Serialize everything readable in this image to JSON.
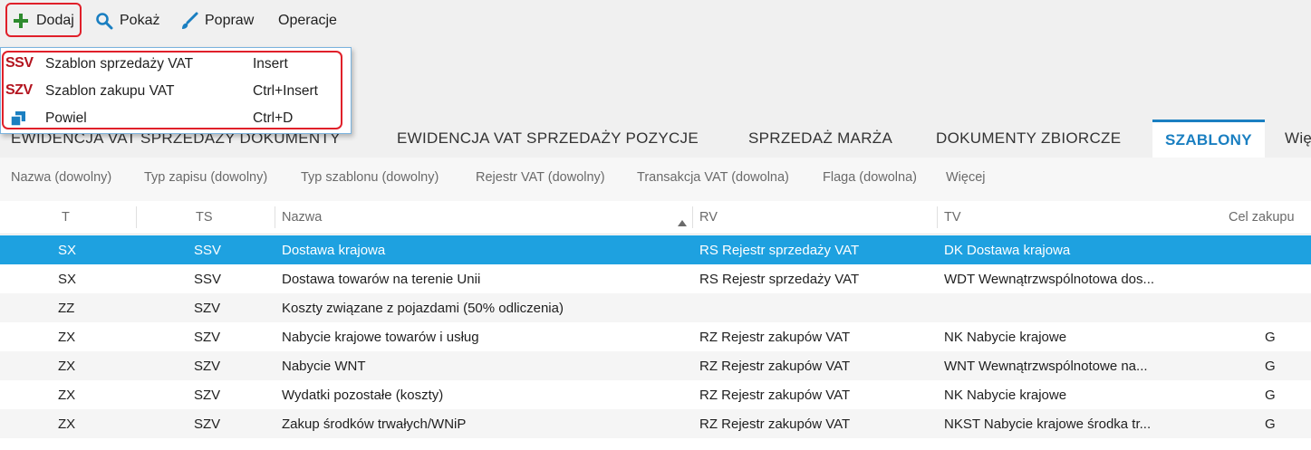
{
  "toolbar": {
    "add_label": "Dodaj",
    "show_label": "Pokaż",
    "edit_label": "Popraw",
    "operations_label": "Operacje"
  },
  "add_menu": {
    "items": [
      {
        "code": "SSV",
        "label": "Szablon sprzedaży VAT",
        "shortcut": "Insert"
      },
      {
        "code": "SZV",
        "label": "Szablon zakupu VAT",
        "shortcut": "Ctrl+Insert"
      },
      {
        "code": "",
        "label": "Powiel",
        "shortcut": "Ctrl+D"
      }
    ]
  },
  "tabs": [
    {
      "label": "EWIDENCJA VAT SPRZEDAŻY DOKUMENTY"
    },
    {
      "label": "EWIDENCJA VAT SPRZEDAŻY POZYCJE"
    },
    {
      "label": "SPRZEDAŻ MARŻA"
    },
    {
      "label": "DOKUMENTY ZBIORCZE"
    },
    {
      "label": "SZABLONY"
    },
    {
      "label": "Wię"
    }
  ],
  "active_tab": "SZABLONY",
  "filters": [
    "Nazwa (dowolny)",
    "Typ zapisu (dowolny)",
    "Typ szablonu (dowolny)",
    "Rejestr VAT (dowolny)",
    "Transakcja VAT (dowolna)",
    "Flaga (dowolna)",
    "Więcej"
  ],
  "columns": {
    "t": "T",
    "ts": "TS",
    "nazwa": "Nazwa",
    "rv": "RV",
    "tv": "TV",
    "cel": "Cel zakupu"
  },
  "rows": [
    {
      "t": "SX",
      "ts": "SSV",
      "nazwa": "Dostawa krajowa",
      "rv": "RS Rejestr sprzedaży VAT",
      "tv": "DK Dostawa krajowa",
      "cel": ""
    },
    {
      "t": "SX",
      "ts": "SSV",
      "nazwa": "Dostawa towarów na terenie Unii",
      "rv": "RS Rejestr sprzedaży VAT",
      "tv": "WDT Wewnątrzwspólnotowa dos...",
      "cel": ""
    },
    {
      "t": "ZZ",
      "ts": "SZV",
      "nazwa": "Koszty związane z pojazdami (50% odliczenia)",
      "rv": "",
      "tv": "",
      "cel": ""
    },
    {
      "t": "ZX",
      "ts": "SZV",
      "nazwa": "Nabycie krajowe towarów i usług",
      "rv": "RZ Rejestr zakupów VAT",
      "tv": "NK Nabycie krajowe",
      "cel": "G"
    },
    {
      "t": "ZX",
      "ts": "SZV",
      "nazwa": "Nabycie WNT",
      "rv": "RZ Rejestr zakupów VAT",
      "tv": "WNT Wewnątrzwspólnotowe na...",
      "cel": "G"
    },
    {
      "t": "ZX",
      "ts": "SZV",
      "nazwa": "Wydatki pozostałe (koszty)",
      "rv": "RZ Rejestr zakupów VAT",
      "tv": "NK Nabycie krajowe",
      "cel": "G"
    },
    {
      "t": "ZX",
      "ts": "SZV",
      "nazwa": "Zakup środków trwałych/WNiP",
      "rv": "RZ Rejestr zakupów VAT",
      "tv": "NKST Nabycie krajowe środka tr...",
      "cel": "G"
    }
  ],
  "selected_row": 0,
  "colors": {
    "accent": "#1a7fc1",
    "selection": "#1ea1e0",
    "highlight_outline": "#e0202a",
    "code_red": "#b3141f",
    "add_green": "#2e8b2e"
  },
  "icons": {
    "add": "plus-icon",
    "show": "search-icon",
    "edit": "brush-icon",
    "duplicate": "duplicate-icon",
    "sort": "sort-ascending-icon"
  }
}
